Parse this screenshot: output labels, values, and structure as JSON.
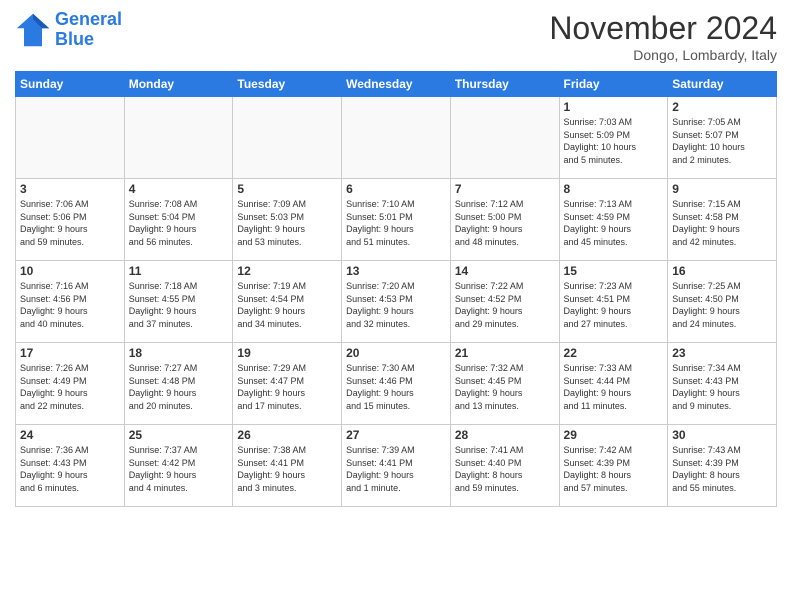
{
  "logo": {
    "line1": "General",
    "line2": "Blue"
  },
  "title": "November 2024",
  "location": "Dongo, Lombardy, Italy",
  "weekdays": [
    "Sunday",
    "Monday",
    "Tuesday",
    "Wednesday",
    "Thursday",
    "Friday",
    "Saturday"
  ],
  "weeks": [
    [
      {
        "day": "",
        "info": ""
      },
      {
        "day": "",
        "info": ""
      },
      {
        "day": "",
        "info": ""
      },
      {
        "day": "",
        "info": ""
      },
      {
        "day": "",
        "info": ""
      },
      {
        "day": "1",
        "info": "Sunrise: 7:03 AM\nSunset: 5:09 PM\nDaylight: 10 hours\nand 5 minutes."
      },
      {
        "day": "2",
        "info": "Sunrise: 7:05 AM\nSunset: 5:07 PM\nDaylight: 10 hours\nand 2 minutes."
      }
    ],
    [
      {
        "day": "3",
        "info": "Sunrise: 7:06 AM\nSunset: 5:06 PM\nDaylight: 9 hours\nand 59 minutes."
      },
      {
        "day": "4",
        "info": "Sunrise: 7:08 AM\nSunset: 5:04 PM\nDaylight: 9 hours\nand 56 minutes."
      },
      {
        "day": "5",
        "info": "Sunrise: 7:09 AM\nSunset: 5:03 PM\nDaylight: 9 hours\nand 53 minutes."
      },
      {
        "day": "6",
        "info": "Sunrise: 7:10 AM\nSunset: 5:01 PM\nDaylight: 9 hours\nand 51 minutes."
      },
      {
        "day": "7",
        "info": "Sunrise: 7:12 AM\nSunset: 5:00 PM\nDaylight: 9 hours\nand 48 minutes."
      },
      {
        "day": "8",
        "info": "Sunrise: 7:13 AM\nSunset: 4:59 PM\nDaylight: 9 hours\nand 45 minutes."
      },
      {
        "day": "9",
        "info": "Sunrise: 7:15 AM\nSunset: 4:58 PM\nDaylight: 9 hours\nand 42 minutes."
      }
    ],
    [
      {
        "day": "10",
        "info": "Sunrise: 7:16 AM\nSunset: 4:56 PM\nDaylight: 9 hours\nand 40 minutes."
      },
      {
        "day": "11",
        "info": "Sunrise: 7:18 AM\nSunset: 4:55 PM\nDaylight: 9 hours\nand 37 minutes."
      },
      {
        "day": "12",
        "info": "Sunrise: 7:19 AM\nSunset: 4:54 PM\nDaylight: 9 hours\nand 34 minutes."
      },
      {
        "day": "13",
        "info": "Sunrise: 7:20 AM\nSunset: 4:53 PM\nDaylight: 9 hours\nand 32 minutes."
      },
      {
        "day": "14",
        "info": "Sunrise: 7:22 AM\nSunset: 4:52 PM\nDaylight: 9 hours\nand 29 minutes."
      },
      {
        "day": "15",
        "info": "Sunrise: 7:23 AM\nSunset: 4:51 PM\nDaylight: 9 hours\nand 27 minutes."
      },
      {
        "day": "16",
        "info": "Sunrise: 7:25 AM\nSunset: 4:50 PM\nDaylight: 9 hours\nand 24 minutes."
      }
    ],
    [
      {
        "day": "17",
        "info": "Sunrise: 7:26 AM\nSunset: 4:49 PM\nDaylight: 9 hours\nand 22 minutes."
      },
      {
        "day": "18",
        "info": "Sunrise: 7:27 AM\nSunset: 4:48 PM\nDaylight: 9 hours\nand 20 minutes."
      },
      {
        "day": "19",
        "info": "Sunrise: 7:29 AM\nSunset: 4:47 PM\nDaylight: 9 hours\nand 17 minutes."
      },
      {
        "day": "20",
        "info": "Sunrise: 7:30 AM\nSunset: 4:46 PM\nDaylight: 9 hours\nand 15 minutes."
      },
      {
        "day": "21",
        "info": "Sunrise: 7:32 AM\nSunset: 4:45 PM\nDaylight: 9 hours\nand 13 minutes."
      },
      {
        "day": "22",
        "info": "Sunrise: 7:33 AM\nSunset: 4:44 PM\nDaylight: 9 hours\nand 11 minutes."
      },
      {
        "day": "23",
        "info": "Sunrise: 7:34 AM\nSunset: 4:43 PM\nDaylight: 9 hours\nand 9 minutes."
      }
    ],
    [
      {
        "day": "24",
        "info": "Sunrise: 7:36 AM\nSunset: 4:43 PM\nDaylight: 9 hours\nand 6 minutes."
      },
      {
        "day": "25",
        "info": "Sunrise: 7:37 AM\nSunset: 4:42 PM\nDaylight: 9 hours\nand 4 minutes."
      },
      {
        "day": "26",
        "info": "Sunrise: 7:38 AM\nSunset: 4:41 PM\nDaylight: 9 hours\nand 3 minutes."
      },
      {
        "day": "27",
        "info": "Sunrise: 7:39 AM\nSunset: 4:41 PM\nDaylight: 9 hours\nand 1 minute."
      },
      {
        "day": "28",
        "info": "Sunrise: 7:41 AM\nSunset: 4:40 PM\nDaylight: 8 hours\nand 59 minutes."
      },
      {
        "day": "29",
        "info": "Sunrise: 7:42 AM\nSunset: 4:39 PM\nDaylight: 8 hours\nand 57 minutes."
      },
      {
        "day": "30",
        "info": "Sunrise: 7:43 AM\nSunset: 4:39 PM\nDaylight: 8 hours\nand 55 minutes."
      }
    ]
  ]
}
